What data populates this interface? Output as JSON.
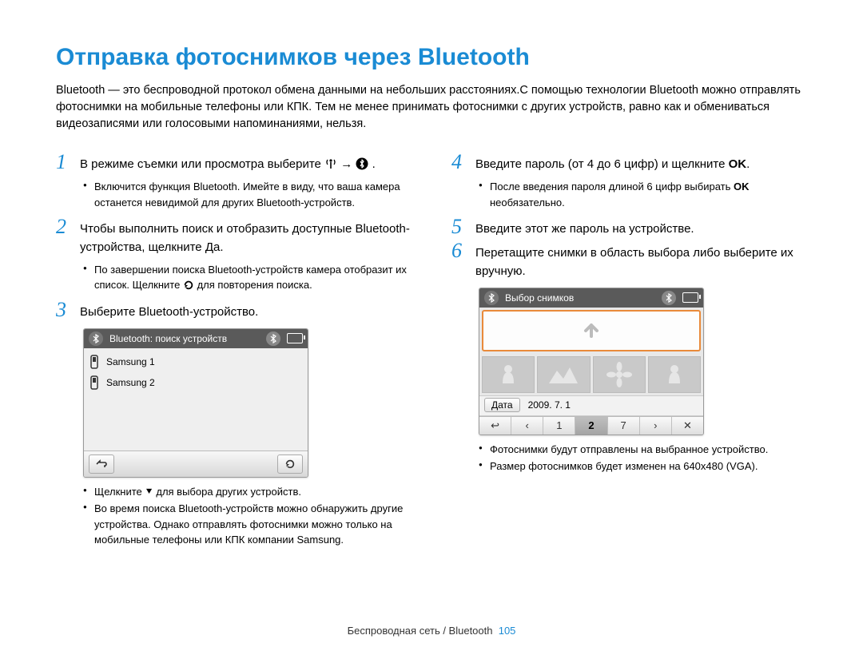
{
  "title": "Отправка фотоснимков через Bluetooth",
  "intro": "Bluetooth — это беспроводной протокол обмена данными на небольших расстояниях.С помощью технологии Bluetooth можно отправлять фотоснимки на мобильные телефоны или КПК. Тем не менее принимать фотоснимки с других устройств, равно как и обмениваться видеозаписями или голосовыми напоминаниями, нельзя.",
  "left": {
    "step1_a": "В режиме съемки или просмотра выберите ",
    "step1_arrow": "→",
    "step1_end": ".",
    "step1_bullets": [
      "Включится функция Bluetooth. Имейте в виду, что ваша камера останется невидимой для других Bluetooth-устройств."
    ],
    "step2": "Чтобы выполнить поиск и отобразить доступные Bluetooth-устройства, щелкните Да.",
    "step2_bullets_a": "По завершении поиска Bluetooth-устройств камера отобразит их список. Щелкните ",
    "step2_bullets_b": " для повторения поиска.",
    "step3": "Выберите Bluetooth-устройство.",
    "device1": {
      "header": "Bluetooth: поиск устройств",
      "items": [
        "Samsung 1",
        "Samsung 2"
      ]
    },
    "step3_bullets": [
      "Щелкните ⯆ для выбора других устройств.",
      "Во время поиска Bluetooth-устройств можно обнаружить другие устройства. Однако отправлять фотоснимки можно только на мобильные телефоны или КПК компании Samsung."
    ]
  },
  "right": {
    "step4_a": "Введите пароль (от 4 до 6 цифр) и щелкните ",
    "step4_ok": "OK",
    "step4_end": ".",
    "step4_bullets_a": "После введения пароля длиной 6 цифр выбирать ",
    "step4_bullets_ok": "OK",
    "step4_bullets_b": " необязательно.",
    "step5": "Введите этот же пароль на устройстве.",
    "step6": "Перетащите снимки в область выбора либо выберите их вручную.",
    "device2": {
      "header": "Выбор снимков",
      "date_label": "Дата",
      "date_value": "2009. 7. 1",
      "nav": [
        "↩",
        "‹",
        "1",
        "2",
        "7",
        "›",
        "✕"
      ]
    },
    "step6_bullets": [
      "Фотоснимки будут отправлены на выбранное устройство.",
      "Размер фотоснимков будет изменен на 640x480 (VGA)."
    ]
  },
  "nums": {
    "n1": "1",
    "n2": "2",
    "n3": "3",
    "n4": "4",
    "n5": "5",
    "n6": "6"
  },
  "footer": {
    "text": "Беспроводная сеть / Bluetooth",
    "page": "105"
  }
}
